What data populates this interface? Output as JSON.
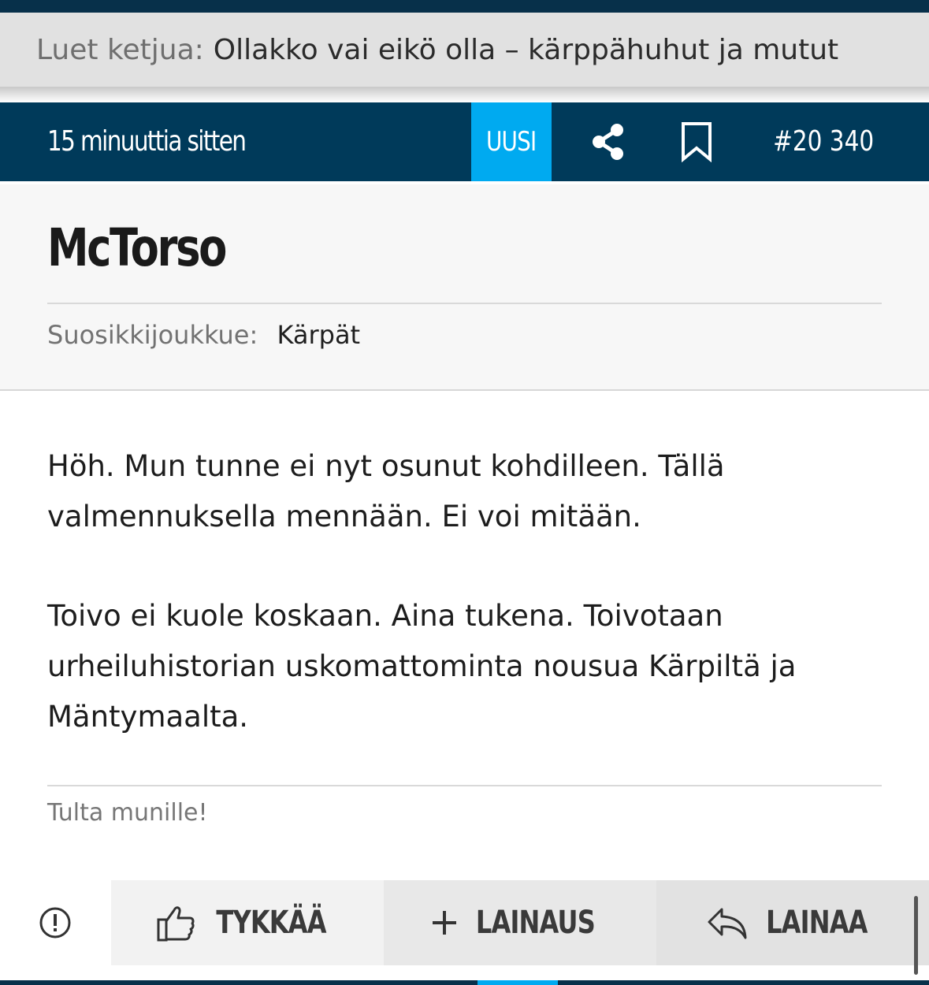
{
  "thread_bar": {
    "prefix": "Luet ketjua:",
    "title": "Ollakko vai eikö olla – kärppähuhut ja mutut"
  },
  "post_header": {
    "time": "15 minuuttia sitten",
    "new_badge": "UUSI",
    "share_icon": "share-icon",
    "bookmark_icon": "bookmark-icon",
    "post_number": "#20 340"
  },
  "author": {
    "name": "McTorso",
    "team_label": "Suosikkijoukkue:",
    "team_value": "Kärpät"
  },
  "post": {
    "paragraphs": [
      "Höh. Mun tunne ei nyt osunut kohdilleen. Tällä valmennuksella mennään. Ei voi mitään.",
      "Toivo ei kuole koskaan. Aina tukena. Toivotaan urheiluhistorian uskomattominta nousua Kärpiltä ja Mäntymaalta."
    ],
    "signature": "Tulta munille!"
  },
  "actions": {
    "report_icon": "exclamation-circle-icon",
    "like_label": "TYKKÄÄ",
    "like_icon": "thumbs-up-icon",
    "quote_add_label": "LAINAUS",
    "quote_add_icon": "plus-icon",
    "quote_label": "LAINAA",
    "quote_icon": "reply-arrow-icon"
  },
  "colors": {
    "header_bg": "#003a5a",
    "badge_bg": "#00aaf0",
    "thread_bar_bg": "#e1e1e1"
  }
}
